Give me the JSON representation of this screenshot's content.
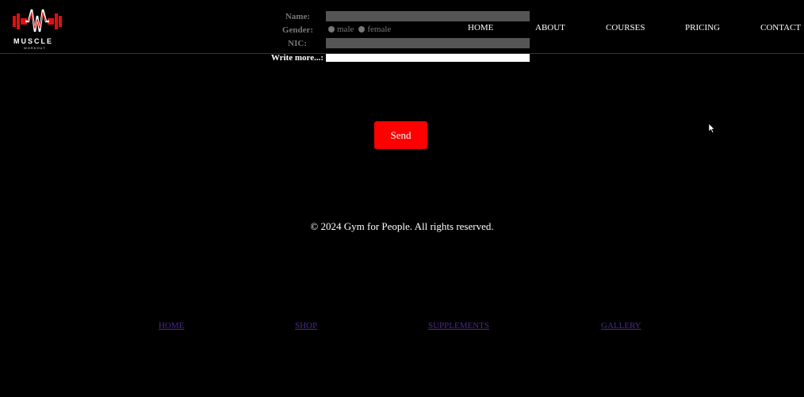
{
  "logo": {
    "text": "MUSCLE",
    "subtext": "WORKOUT",
    "accent_color": "#e01010"
  },
  "form": {
    "name_label": "Name:",
    "gender_label": "Gender:",
    "gender_options": [
      "male",
      "female"
    ],
    "nic_label": "NIC:",
    "write_more_label": "Write more...:",
    "name_value": "",
    "nic_value": "",
    "write_more_value": "",
    "send_label": "Send"
  },
  "nav": {
    "items": [
      "HOME",
      "ABOUT",
      "COURSES",
      "PRICING",
      "CONTACT"
    ]
  },
  "copyright": "© 2024 Gym for People. All rights reserved.",
  "footer": {
    "links": [
      "HOME",
      "SHOP",
      "SUPPLEMENTS",
      "GALLERY"
    ]
  },
  "colors": {
    "background": "#000000",
    "send_button": "#ff0000",
    "header_line": "#8b0d0d",
    "footer_link": "#4b2a8a"
  }
}
